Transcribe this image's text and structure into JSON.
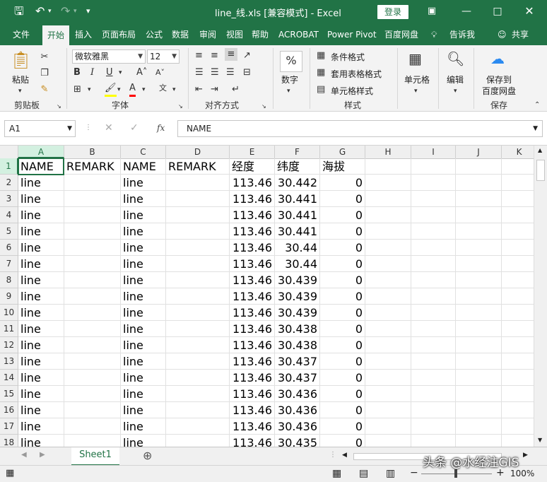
{
  "window": {
    "title": "line_线.xls  [兼容模式]  -  Excel",
    "login_label": "登录"
  },
  "ribbon_tabs": [
    "文件",
    "开始",
    "插入",
    "页面布局",
    "公式",
    "数据",
    "审阅",
    "视图",
    "帮助",
    "ACROBAT",
    "Power Pivot",
    "百度网盘"
  ],
  "tell_me": "告诉我",
  "share": "共享",
  "ribbon": {
    "clipboard": {
      "paste": "粘贴",
      "label": "剪贴板"
    },
    "font": {
      "name": "微软雅黑",
      "size": "12",
      "label": "字体"
    },
    "alignment": {
      "label": "对齐方式"
    },
    "number": {
      "format": "数字",
      "symbol": "%"
    },
    "styles": {
      "conditional": "条件格式",
      "table": "套用表格格式",
      "cell": "单元格样式",
      "label": "样式"
    },
    "cells": {
      "label": "单元格"
    },
    "editing": {
      "label": "编辑"
    },
    "save": {
      "line1": "保存到",
      "line2": "百度网盘",
      "label": "保存"
    }
  },
  "formula_bar": {
    "name_box": "A1",
    "content": "NAME",
    "fx": "fx"
  },
  "columns": [
    "A",
    "B",
    "C",
    "D",
    "E",
    "F",
    "G",
    "H",
    "I",
    "J",
    "K"
  ],
  "rows": [
    [
      "NAME",
      "REMARK",
      "NAME",
      "REMARK",
      "经度",
      "纬度",
      "海拔"
    ],
    [
      "line",
      "",
      "line",
      "",
      "113.46",
      "30.442",
      "0"
    ],
    [
      "line",
      "",
      "line",
      "",
      "113.46",
      "30.441",
      "0"
    ],
    [
      "line",
      "",
      "line",
      "",
      "113.46",
      "30.441",
      "0"
    ],
    [
      "line",
      "",
      "line",
      "",
      "113.46",
      "30.441",
      "0"
    ],
    [
      "line",
      "",
      "line",
      "",
      "113.46",
      "30.44",
      "0"
    ],
    [
      "line",
      "",
      "line",
      "",
      "113.46",
      "30.44",
      "0"
    ],
    [
      "line",
      "",
      "line",
      "",
      "113.46",
      "30.439",
      "0"
    ],
    [
      "line",
      "",
      "line",
      "",
      "113.46",
      "30.439",
      "0"
    ],
    [
      "line",
      "",
      "line",
      "",
      "113.46",
      "30.439",
      "0"
    ],
    [
      "line",
      "",
      "line",
      "",
      "113.46",
      "30.438",
      "0"
    ],
    [
      "line",
      "",
      "line",
      "",
      "113.46",
      "30.438",
      "0"
    ],
    [
      "line",
      "",
      "line",
      "",
      "113.46",
      "30.437",
      "0"
    ],
    [
      "line",
      "",
      "line",
      "",
      "113.46",
      "30.437",
      "0"
    ],
    [
      "line",
      "",
      "line",
      "",
      "113.46",
      "30.436",
      "0"
    ],
    [
      "line",
      "",
      "line",
      "",
      "113.46",
      "30.436",
      "0"
    ],
    [
      "line",
      "",
      "line",
      "",
      "113.46",
      "30.436",
      "0"
    ],
    [
      "line",
      "",
      "line",
      "",
      "113.46",
      "30.435",
      "0"
    ]
  ],
  "sheets": [
    "Sheet1"
  ],
  "status": {
    "zoom": "100%"
  },
  "watermark": "头条 @水经注GIS"
}
